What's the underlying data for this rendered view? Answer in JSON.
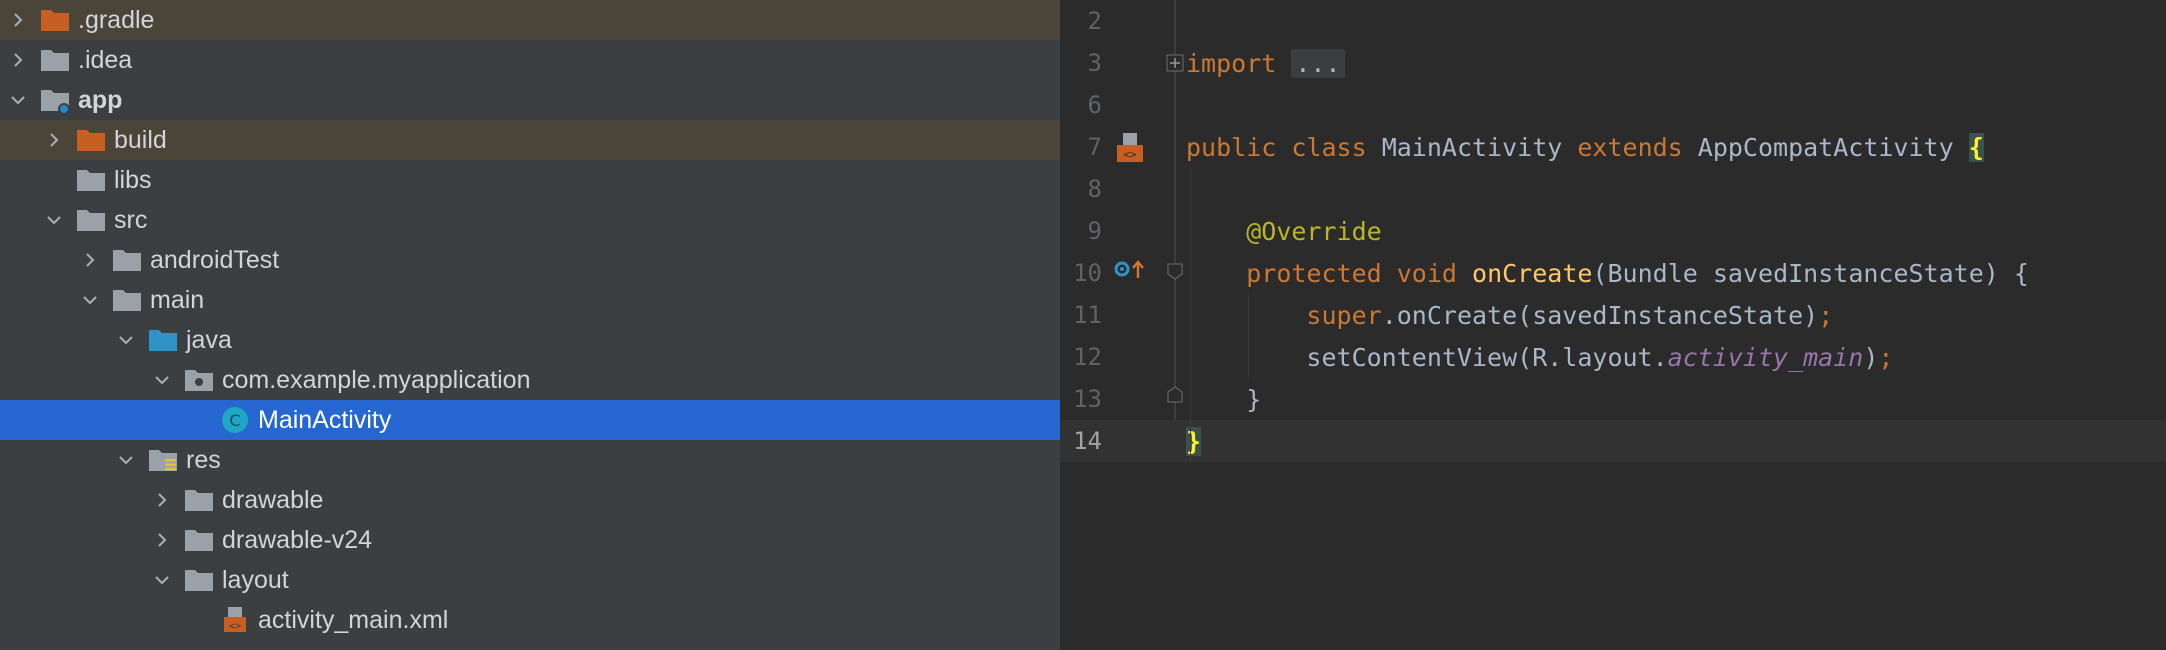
{
  "tree": {
    "items": [
      {
        "label": ".gradle",
        "chevron": "right",
        "icon": "folder-orange",
        "bold": false,
        "highlight": true,
        "selected": false,
        "depth": 0
      },
      {
        "label": ".idea",
        "chevron": "right",
        "icon": "folder-gray",
        "bold": false,
        "highlight": false,
        "selected": false,
        "depth": 0
      },
      {
        "label": "app",
        "chevron": "down",
        "icon": "folder-module",
        "bold": true,
        "highlight": false,
        "selected": false,
        "depth": 0
      },
      {
        "label": "build",
        "chevron": "right",
        "icon": "folder-orange",
        "bold": false,
        "highlight": true,
        "selected": false,
        "depth": 1
      },
      {
        "label": "libs",
        "chevron": "none",
        "icon": "folder-gray",
        "bold": false,
        "highlight": false,
        "selected": false,
        "depth": 1
      },
      {
        "label": "src",
        "chevron": "down",
        "icon": "folder-gray",
        "bold": false,
        "highlight": false,
        "selected": false,
        "depth": 1
      },
      {
        "label": "androidTest",
        "chevron": "right",
        "icon": "folder-gray",
        "bold": false,
        "highlight": false,
        "selected": false,
        "depth": 2
      },
      {
        "label": "main",
        "chevron": "down",
        "icon": "folder-gray",
        "bold": false,
        "highlight": false,
        "selected": false,
        "depth": 2
      },
      {
        "label": "java",
        "chevron": "down",
        "icon": "folder-blue",
        "bold": false,
        "highlight": false,
        "selected": false,
        "depth": 3
      },
      {
        "label": "com.example.myapplication",
        "chevron": "down",
        "icon": "folder-package",
        "bold": false,
        "highlight": false,
        "selected": false,
        "depth": 4
      },
      {
        "label": "MainActivity",
        "chevron": "none",
        "icon": "class-c",
        "bold": false,
        "highlight": false,
        "selected": true,
        "depth": 5
      },
      {
        "label": "res",
        "chevron": "down",
        "icon": "folder-res",
        "bold": false,
        "highlight": false,
        "selected": false,
        "depth": 3
      },
      {
        "label": "drawable",
        "chevron": "right",
        "icon": "folder-gray",
        "bold": false,
        "highlight": false,
        "selected": false,
        "depth": 4
      },
      {
        "label": "drawable-v24",
        "chevron": "right",
        "icon": "folder-gray",
        "bold": false,
        "highlight": false,
        "selected": false,
        "depth": 4
      },
      {
        "label": "layout",
        "chevron": "down",
        "icon": "folder-gray",
        "bold": false,
        "highlight": false,
        "selected": false,
        "depth": 4
      },
      {
        "label": "activity_main.xml",
        "chevron": "none",
        "icon": "xml-layout",
        "bold": false,
        "highlight": false,
        "selected": false,
        "depth": 5
      }
    ]
  },
  "editor": {
    "lines": [
      {
        "num": "2",
        "current": false
      },
      {
        "num": "3",
        "current": false,
        "tokens": [
          {
            "t": "import",
            "c": "kw"
          },
          {
            "t": " "
          },
          {
            "t": "...",
            "c": "fold"
          }
        ]
      },
      {
        "num": "6",
        "current": false
      },
      {
        "num": "7",
        "current": false,
        "tokens": [
          {
            "t": "public",
            "c": "kw"
          },
          {
            "t": " "
          },
          {
            "t": "class",
            "c": "kw"
          },
          {
            "t": " MainActivity "
          },
          {
            "t": "extends",
            "c": "kw"
          },
          {
            "t": " AppCompatActivity "
          },
          {
            "t": "{",
            "c": "brace"
          }
        ]
      },
      {
        "num": "8",
        "current": false
      },
      {
        "num": "9",
        "current": false,
        "tokens": [
          {
            "t": "    "
          },
          {
            "t": "@Override",
            "c": "an"
          }
        ]
      },
      {
        "num": "10",
        "current": false,
        "tokens": [
          {
            "t": "    "
          },
          {
            "t": "protected",
            "c": "kw"
          },
          {
            "t": " "
          },
          {
            "t": "void",
            "c": "kw"
          },
          {
            "t": " "
          },
          {
            "t": "onCreate",
            "c": "fn"
          },
          {
            "t": "(Bundle savedInstanceState) {"
          }
        ]
      },
      {
        "num": "11",
        "current": false,
        "tokens": [
          {
            "t": "        "
          },
          {
            "t": "super",
            "c": "kw"
          },
          {
            "t": ".onCreate(savedInstanceState)"
          },
          {
            "t": ";",
            "c": "kw"
          }
        ]
      },
      {
        "num": "12",
        "current": false,
        "tokens": [
          {
            "t": "        "
          },
          {
            "t": "setContentView(R.layout."
          },
          {
            "t": "activity_main",
            "c": "it"
          },
          {
            "t": ")"
          },
          {
            "t": ";",
            "c": "kw"
          }
        ]
      },
      {
        "num": "13",
        "current": false,
        "tokens": [
          {
            "t": "    }"
          }
        ]
      },
      {
        "num": "14",
        "current": true,
        "tokens": [
          {
            "t": "}",
            "c": "brace"
          }
        ]
      }
    ]
  },
  "colors": {
    "tree_bg": "#3c3f41",
    "selection": "#2566d1",
    "highlight_row": "#4b4439",
    "editor_bg": "#2b2b2b",
    "keyword": "#cc7832",
    "annotation": "#bbb529",
    "method": "#ffc66d",
    "field_italic": "#9876aa"
  }
}
